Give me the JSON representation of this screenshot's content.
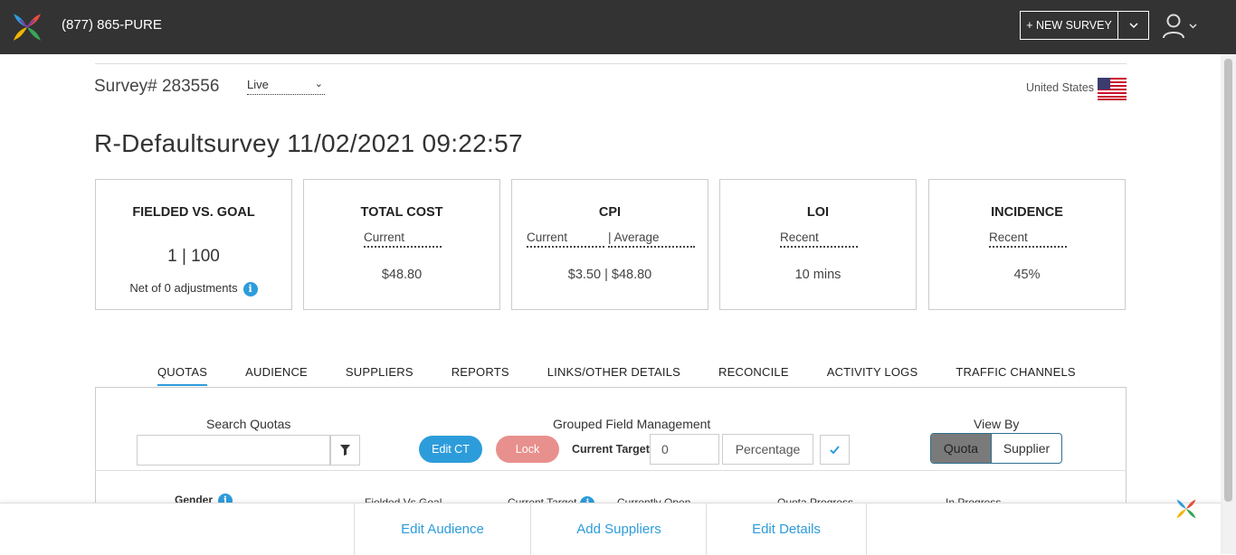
{
  "header": {
    "phone": "(877) 865-PURE",
    "new_survey_label": "+ NEW SURVEY"
  },
  "survey": {
    "number_label": "Survey# 283556",
    "status": "Live",
    "country": "United States",
    "title": "R-Defaultsurvey 11/02/2021 09:22:57"
  },
  "cards": {
    "fielded": {
      "title": "FIELDED VS. GOAL",
      "value": "1 | 100",
      "note": "Net of 0 adjustments"
    },
    "total_cost": {
      "title": "TOTAL COST",
      "sub": "Current",
      "value": "$48.80"
    },
    "cpi": {
      "title": "CPI",
      "sub_a": "Current",
      "sub_b": "| Average",
      "value": "$3.50 | $48.80"
    },
    "loi": {
      "title": "LOI",
      "sub": "Recent",
      "value": "10 mins"
    },
    "incidence": {
      "title": "INCIDENCE",
      "sub": "Recent",
      "value": "45%"
    }
  },
  "tabs": [
    "QUOTAS",
    "AUDIENCE",
    "SUPPLIERS",
    "REPORTS",
    "LINKS/OTHER DETAILS",
    "RECONCILE",
    "ACTIVITY LOGS",
    "TRAFFIC CHANNELS"
  ],
  "quotas": {
    "search_label": "Search Quotas",
    "search_value": "",
    "grouped_label": "Grouped Field Management",
    "edit_ct": "Edit CT",
    "lock": "Lock",
    "current_target_label": "Current Target",
    "current_target_value": "0",
    "percentage": "Percentage",
    "view_by_label": "View By",
    "view_quota": "Quota",
    "view_supplier": "Supplier",
    "columns": {
      "gender": "Gender",
      "fielded": "Fielded Vs Goal",
      "current_target": "Current Target",
      "currently_open": "Currently Open",
      "quota_progress": "Quota Progress",
      "in_progress": "In Progress"
    }
  },
  "footer": {
    "edit_audience": "Edit Audience",
    "add_suppliers": "Add Suppliers",
    "edit_details": "Edit Details"
  },
  "colors": {
    "accent": "#2d9cdb",
    "topbar": "#333333",
    "lock": "#e8908d"
  }
}
